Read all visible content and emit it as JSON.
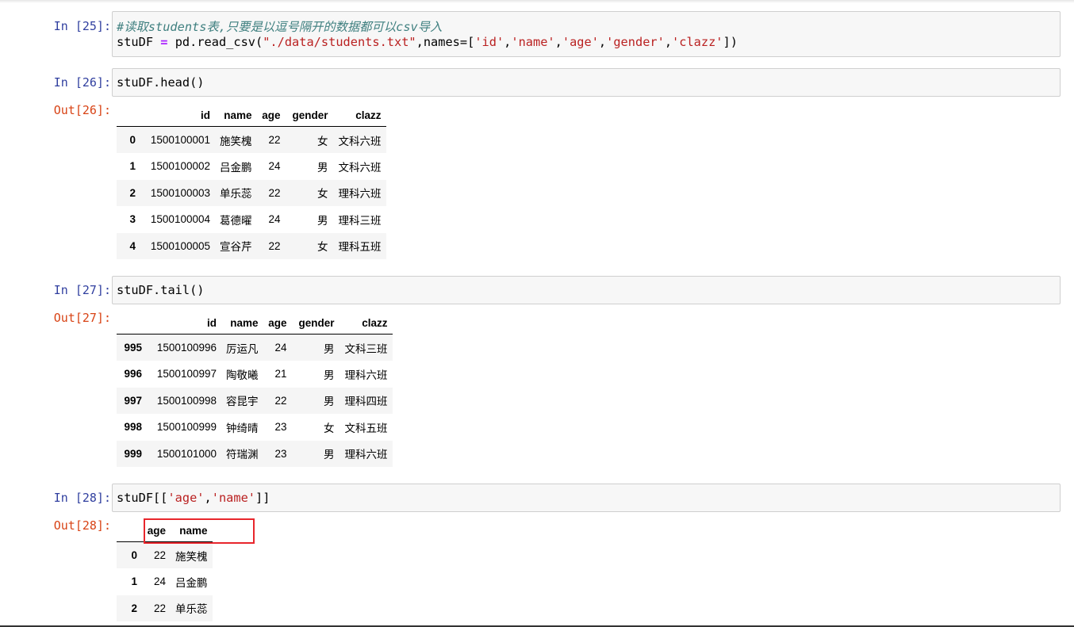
{
  "cells": [
    {
      "in_prompt": "In  [25]:",
      "code": {
        "comment": "#读取students表,只要是以逗号隔开的数据都可以csv导入",
        "line2": [
          "stuDF ",
          "=",
          " pd.read_csv(",
          "\"./data/students.txt\"",
          ",names=[",
          "'id'",
          ",",
          "'name'",
          ",",
          "'age'",
          ",",
          "'gender'",
          ",",
          "'clazz'",
          "])"
        ]
      }
    },
    {
      "in_prompt": "In  [26]:",
      "code": "stuDF.head()",
      "out_prompt": "Out[26]:",
      "table": {
        "columns": [
          "",
          "id",
          "name",
          "age",
          "gender",
          "clazz"
        ],
        "rows": [
          [
            "0",
            "1500100001",
            "施笑槐",
            "22",
            "女",
            "文科六班"
          ],
          [
            "1",
            "1500100002",
            "吕金鹏",
            "24",
            "男",
            "文科六班"
          ],
          [
            "2",
            "1500100003",
            "单乐蕊",
            "22",
            "女",
            "理科六班"
          ],
          [
            "3",
            "1500100004",
            "葛德曜",
            "24",
            "男",
            "理科三班"
          ],
          [
            "4",
            "1500100005",
            "宣谷芹",
            "22",
            "女",
            "理科五班"
          ]
        ]
      }
    },
    {
      "in_prompt": "In  [27]:",
      "code": "stuDF.tail()",
      "out_prompt": "Out[27]:",
      "table": {
        "columns": [
          "",
          "id",
          "name",
          "age",
          "gender",
          "clazz"
        ],
        "rows": [
          [
            "995",
            "1500100996",
            "厉运凡",
            "24",
            "男",
            "文科三班"
          ],
          [
            "996",
            "1500100997",
            "陶敬曦",
            "21",
            "男",
            "理科六班"
          ],
          [
            "997",
            "1500100998",
            "容昆宇",
            "22",
            "男",
            "理科四班"
          ],
          [
            "998",
            "1500100999",
            "钟绮晴",
            "23",
            "女",
            "文科五班"
          ],
          [
            "999",
            "1500101000",
            "符瑞渊",
            "23",
            "男",
            "理科六班"
          ]
        ]
      }
    },
    {
      "in_prompt": "In  [28]:",
      "code": [
        "stuDF[[",
        "'age'",
        ",",
        "'name'",
        "]]"
      ],
      "out_prompt": "Out[28]:",
      "table": {
        "columns": [
          "",
          "age",
          "name"
        ],
        "rows": [
          [
            "0",
            "22",
            "施笑槐"
          ],
          [
            "1",
            "24",
            "吕金鹏"
          ],
          [
            "2",
            "22",
            "单乐蕊"
          ]
        ]
      }
    }
  ],
  "colors": {
    "in_prompt": "#303f9f",
    "out_prompt": "#d84315",
    "highlight_box": "#e8262c",
    "comment": "#408080",
    "string": "#ba2121",
    "operator": "#aa22ff"
  }
}
